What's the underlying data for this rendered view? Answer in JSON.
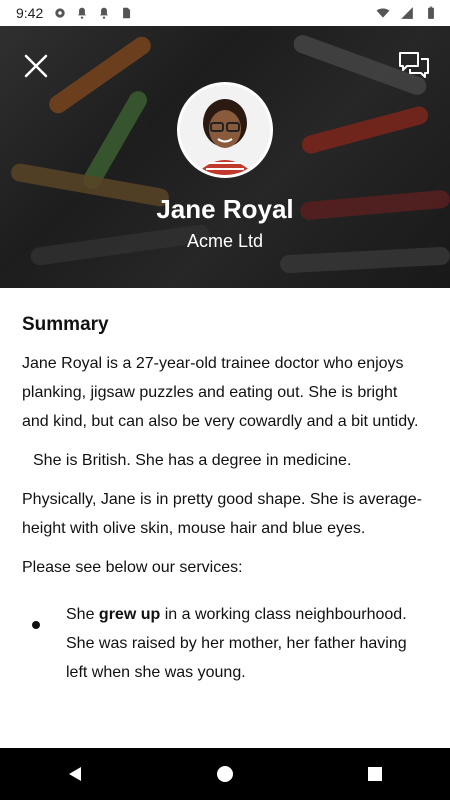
{
  "status_bar": {
    "time": "9:42",
    "icons": [
      "settings-icon",
      "notification-icon",
      "notification-icon",
      "sd-card-icon",
      "wifi-icon",
      "signal-icon",
      "battery-icon"
    ]
  },
  "header": {
    "name": "Jane Royal",
    "company": "Acme Ltd",
    "close_icon": "close-icon",
    "chat_icon": "chat-icon"
  },
  "content": {
    "heading": "Summary",
    "paragraph1": "Jane Royal is a 27-year-old trainee doctor who enjoys planking, jigsaw puzzles and eating out. She is bright and kind, but can also be very cowardly and a bit untidy.",
    "paragraph2": "She is British. She has a degree in medicine.",
    "paragraph3": "Physically, Jane is in pretty good shape. She is average-height with olive skin, mouse hair and blue eyes.",
    "paragraph4": "Please see below our services:",
    "bullet_prefix": "She ",
    "bullet_bold": "grew up",
    "bullet_suffix": " in a working class neighbourhood. She was raised by her mother, her father having left when she was young."
  },
  "navbar": {
    "back_icon": "back-icon",
    "home_icon": "home-icon",
    "recents_icon": "recents-icon"
  },
  "colors": {
    "text": "#111111",
    "header_text": "#ffffff",
    "navbar": "#000000"
  }
}
